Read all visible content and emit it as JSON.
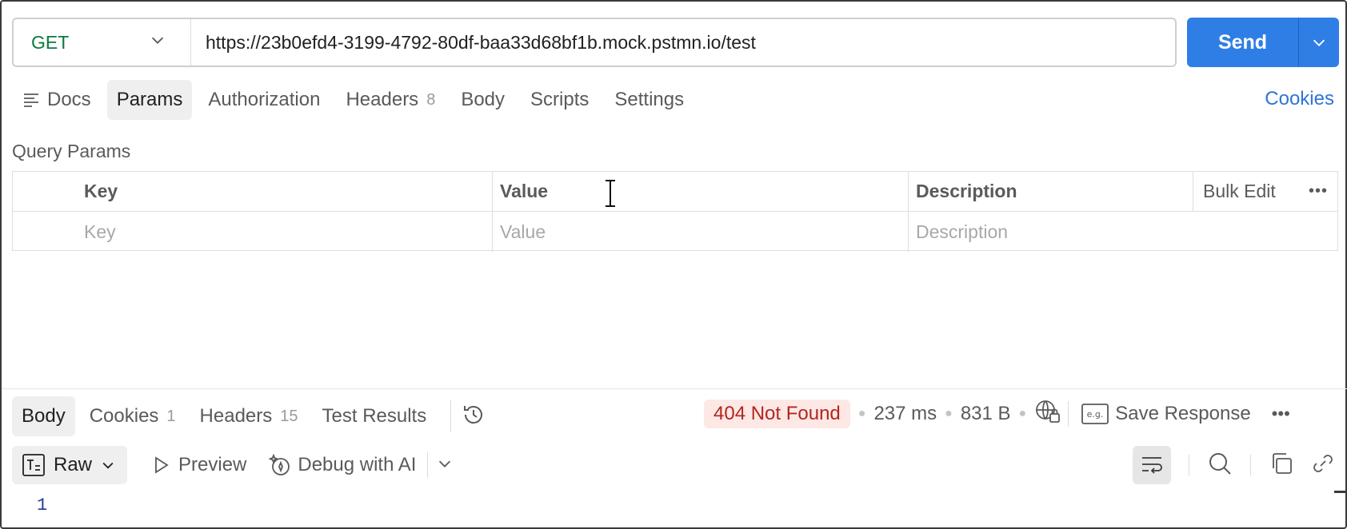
{
  "request": {
    "method": "GET",
    "url": "https://23b0efd4-3199-4792-80df-baa33d68bf1b.mock.pstmn.io/test",
    "send_label": "Send"
  },
  "request_tabs": {
    "docs": "Docs",
    "params": "Params",
    "authorization": "Authorization",
    "headers": "Headers",
    "headers_count": "8",
    "body": "Body",
    "scripts": "Scripts",
    "settings": "Settings",
    "cookies": "Cookies"
  },
  "query_params": {
    "title": "Query Params",
    "columns": {
      "key": "Key",
      "value": "Value",
      "description": "Description",
      "bulk_edit": "Bulk Edit"
    },
    "placeholders": {
      "key": "Key",
      "value": "Value",
      "description": "Description"
    },
    "more": "•••"
  },
  "response": {
    "tabs": {
      "body": "Body",
      "cookies": "Cookies",
      "cookies_count": "1",
      "headers": "Headers",
      "headers_count": "15",
      "test_results": "Test Results"
    },
    "status": "404 Not Found",
    "time": "237 ms",
    "size": "831 B",
    "save_response": "Save Response",
    "more": "•••",
    "format": "Raw",
    "preview": "Preview",
    "debug": "Debug with AI",
    "line_number": "1"
  },
  "colors": {
    "method": "#0b7a3e",
    "send": "#2f7ee6",
    "link": "#2f74d8",
    "status_bg": "#fde8e6",
    "status_text": "#b3261e"
  }
}
